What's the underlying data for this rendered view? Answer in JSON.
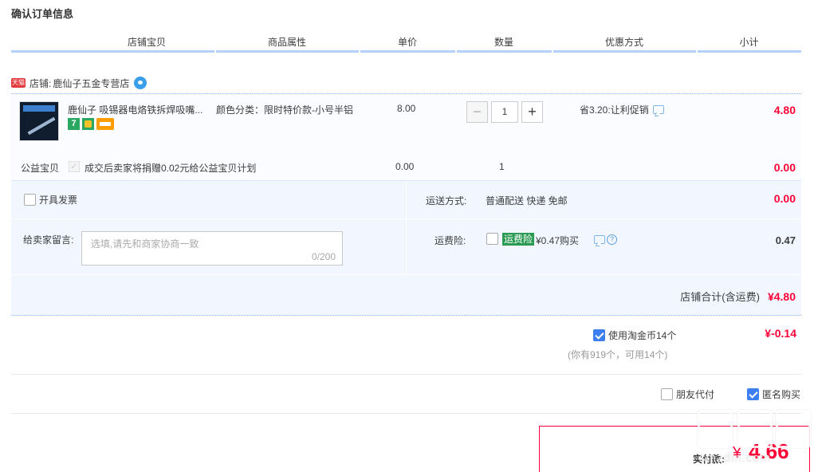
{
  "page": {
    "title": "确认订单信息"
  },
  "columns": [
    "店铺宝贝",
    "商品属性",
    "单价",
    "数量",
    "优惠方式",
    "小计"
  ],
  "shop": {
    "badge": "天猫",
    "label": "店铺:",
    "name": "鹿仙子五金专营店"
  },
  "item": {
    "title": "鹿仙子 吸锡器电烙铁拆焊吸嘴...",
    "attribute": "颜色分类：限时特价款-小号半铝",
    "unit_price": "8.00",
    "quantity": "1",
    "qty_minus": "−",
    "qty_plus": "+",
    "promo": "省3.20:让利促销",
    "subtotal": "4.80",
    "badge_seven": "7"
  },
  "charity": {
    "label": "公益宝贝",
    "desc": "成交后卖家将捐赠0.02元给公益宝贝计划",
    "price": "0.00",
    "qty": "1",
    "subtotal": "0.00"
  },
  "invoice": {
    "label": "开具发票"
  },
  "shipping": {
    "label": "运送方式:",
    "value": "普通配送 快递 免邮",
    "fee": "0.00"
  },
  "message": {
    "label": "给卖家留言:",
    "placeholder": "选填,请先和商家协商一致",
    "counter": "0/200"
  },
  "insurance": {
    "label": "运费险:",
    "tag": "运费险",
    "text": "¥0.47购买",
    "fee": "0.47"
  },
  "shop_total": {
    "label": "店铺合计(含运费)",
    "value": "¥4.80"
  },
  "coins": {
    "label": "使用淘金币14个",
    "value": "¥-0.14",
    "sub": "(你有919个，可用14个)",
    "checked": true
  },
  "friend_pay": {
    "label": "朋友代付",
    "checked": false
  },
  "anonymous": {
    "label": "匿名购买",
    "checked": true
  },
  "payment": {
    "label": "实付款:",
    "currency": "¥",
    "amount": "4.66"
  },
  "watermark": {
    "text": "smzdm.com"
  },
  "colors": {
    "accent_red": "#ff0036",
    "header_line": "#b2d1ff",
    "checkbox_blue": "#3d7ff0",
    "tag_green": "#2a9a52"
  },
  "icons": [
    "tmall-icon",
    "wangwang-icon",
    "chat-icon",
    "question-icon",
    "check-icon"
  ]
}
